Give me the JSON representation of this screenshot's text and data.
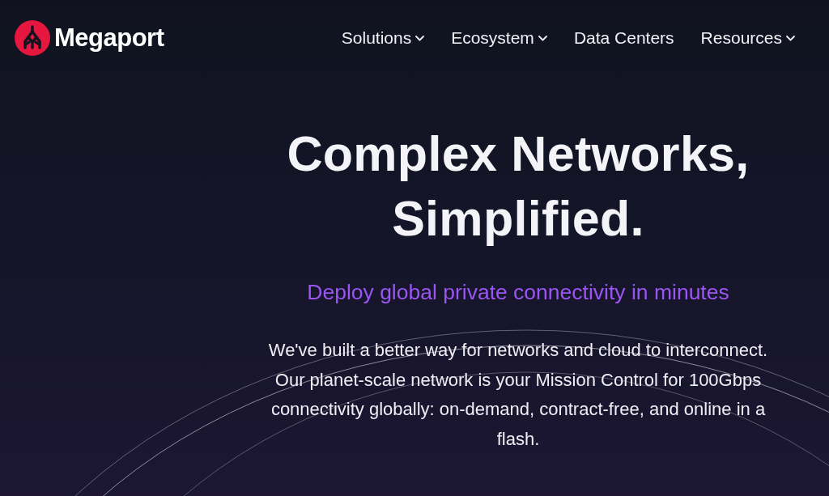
{
  "header": {
    "logo_text": "Megaport",
    "nav": [
      {
        "label": "Solutions",
        "dropdown": true
      },
      {
        "label": "Ecosystem",
        "dropdown": true
      },
      {
        "label": "Data Centers",
        "dropdown": false
      },
      {
        "label": "Resources",
        "dropdown": true
      }
    ]
  },
  "hero": {
    "title": "Complex Networks, Simplified.",
    "tagline": "Deploy global private connectivity in minutes",
    "body": "We've built a better way for networks and cloud to interconnect. Our planet-scale network is your Mission Control for 100Gbps connectivity globally: on-demand, contract-free, and online in a flash."
  }
}
